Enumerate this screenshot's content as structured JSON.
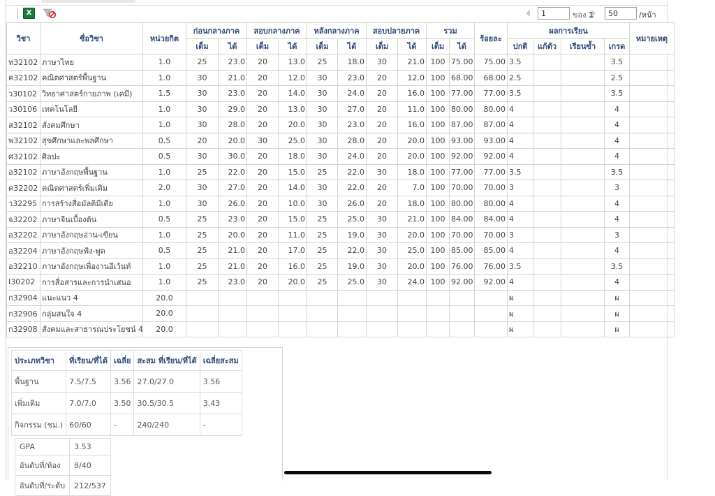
{
  "toolbar": {
    "excel_icon": "X",
    "page_value": "1",
    "of_label": "ของ",
    "total_pages": "1",
    "page_size": "50",
    "per_page_label": "/หน้า"
  },
  "headers": {
    "code": "วิชา",
    "name": "ชื่อวิชา",
    "credit": "หน่วยกิต",
    "groups": [
      "ก่อนกลางภาค",
      "สอบกลางภาค",
      "หลังกลางภาค",
      "สอบปลายภาค",
      "รวม"
    ],
    "percent": "ร้อยละ",
    "result": "ผลการเรียน",
    "remark": "หมายเหตุ",
    "full": "เต็ม",
    "got": "ได้",
    "normal": "ปกติ",
    "fix": "แก้ตัว",
    "repeat": "เรียนซ้ำ",
    "grade": "เกรด"
  },
  "rows": [
    [
      "ท32102",
      "ภาษาไทย",
      "1.0",
      "25",
      "23.0",
      "20",
      "13.0",
      "25",
      "18.0",
      "30",
      "21.0",
      "100",
      "75.00",
      "75.00",
      "3.5",
      "",
      "",
      "3.5",
      ""
    ],
    [
      "ค32102",
      "คณิตศาสตร์พื้นฐาน",
      "1.0",
      "30",
      "21.0",
      "20",
      "12.0",
      "30",
      "23.0",
      "20",
      "12.0",
      "100",
      "68.00",
      "68.00",
      "2.5",
      "",
      "",
      "2.5",
      ""
    ],
    [
      "ว30102",
      "วิทยาศาสตร์กายภาพ (เคมี)",
      "1.5",
      "30",
      "23.0",
      "20",
      "14.0",
      "30",
      "24.0",
      "20",
      "16.0",
      "100",
      "77.00",
      "77.00",
      "3.5",
      "",
      "",
      "3.5",
      ""
    ],
    [
      "ว30106",
      "เทคโนโลยี",
      "1.0",
      "30",
      "29.0",
      "20",
      "13.0",
      "30",
      "27.0",
      "20",
      "11.0",
      "100",
      "80.00",
      "80.00",
      "4",
      "",
      "",
      "4",
      ""
    ],
    [
      "ส32102",
      "สังคมศึกษา",
      "1.0",
      "30",
      "28.0",
      "20",
      "20.0",
      "30",
      "23.0",
      "20",
      "16.0",
      "100",
      "87.00",
      "87.00",
      "4",
      "",
      "",
      "4",
      ""
    ],
    [
      "พ32102",
      "สุขศึกษาและพลศึกษา",
      "0.5",
      "20",
      "20.0",
      "30",
      "25.0",
      "30",
      "28.0",
      "20",
      "20.0",
      "100",
      "93.00",
      "93.00",
      "4",
      "",
      "",
      "4",
      ""
    ],
    [
      "ศ32102",
      "ศิลปะ",
      "0.5",
      "30",
      "30.0",
      "20",
      "18.0",
      "30",
      "24.0",
      "20",
      "20.0",
      "100",
      "92.00",
      "92.00",
      "4",
      "",
      "",
      "4",
      ""
    ],
    [
      "อ32102",
      "ภาษาอังกฤษพื้นฐาน",
      "1.0",
      "25",
      "22.0",
      "20",
      "15.0",
      "25",
      "22.0",
      "30",
      "18.0",
      "100",
      "77.00",
      "77.00",
      "3.5",
      "",
      "",
      "3.5",
      ""
    ],
    [
      "ค32202",
      "คณิตศาสตร์เพิ่มเติม",
      "2.0",
      "30",
      "27.0",
      "20",
      "14.0",
      "30",
      "22.0",
      "20",
      "7.0",
      "100",
      "70.00",
      "70.00",
      "3",
      "",
      "",
      "3",
      ""
    ],
    [
      "ว32295",
      "การสร้างสื่อมัลติมีเดีย",
      "1.0",
      "30",
      "26.0",
      "20",
      "10.0",
      "30",
      "26.0",
      "20",
      "18.0",
      "100",
      "80.00",
      "80.00",
      "4",
      "",
      "",
      "4",
      ""
    ],
    [
      "จ32202",
      "ภาษาจีนเบื้องต้น",
      "0.5",
      "25",
      "23.0",
      "20",
      "15.0",
      "25",
      "25.0",
      "30",
      "21.0",
      "100",
      "84.00",
      "84.00",
      "4",
      "",
      "",
      "4",
      ""
    ],
    [
      "อ32202",
      "ภาษาอังกฤษอ่าน-เขียน",
      "1.0",
      "25",
      "20.0",
      "20",
      "11.0",
      "25",
      "19.0",
      "30",
      "20.0",
      "100",
      "70.00",
      "70.00",
      "3",
      "",
      "",
      "3",
      ""
    ],
    [
      "อ32204",
      "ภาษาอังกฤษฟัง-พูด",
      "0.5",
      "25",
      "21.0",
      "20",
      "17.0",
      "25",
      "22.0",
      "30",
      "25.0",
      "100",
      "85.00",
      "85.00",
      "4",
      "",
      "",
      "4",
      ""
    ],
    [
      "อ32210",
      "ภาษาอังกฤษเพื่องานอีเว้นท์",
      "1.0",
      "25",
      "21.0",
      "20",
      "16.0",
      "25",
      "19.0",
      "30",
      "20.0",
      "100",
      "76.00",
      "76.00",
      "3.5",
      "",
      "",
      "3.5",
      ""
    ],
    [
      "I30202",
      "การสื่อสารและการนำเสนอ",
      "1.0",
      "25",
      "23.0",
      "20",
      "20.0",
      "25",
      "25.0",
      "30",
      "24.0",
      "100",
      "92.00",
      "92.00",
      "4",
      "",
      "",
      "4",
      ""
    ],
    [
      "ก32904",
      "แนะแนว 4",
      "20.0",
      "",
      "",
      "",
      "",
      "",
      "",
      "",
      "",
      "",
      "",
      "",
      "ผ",
      "",
      "",
      "ผ",
      ""
    ],
    [
      "ก32906",
      "กลุ่มสนใจ 4",
      "20.0",
      "",
      "",
      "",
      "",
      "",
      "",
      "",
      "",
      "",
      "",
      "",
      "ผ",
      "",
      "",
      "ผ",
      ""
    ],
    [
      "ก32908",
      "สังคมและสาธารณประโยชน์ 4",
      "20.0",
      "",
      "",
      "",
      "",
      "",
      "",
      "",
      "",
      "",
      "",
      "",
      "ผ",
      "",
      "",
      "ผ",
      ""
    ]
  ],
  "summary": {
    "headers": [
      "ประเภทวิชา",
      "ที่เรียน/ที่ได้",
      "เฉลี่ย",
      "สะสม ที่เรียน/ที่ได้",
      "เฉลี่ยสะสม"
    ],
    "rows": [
      [
        "พื้นฐาน",
        "7.5/7.5",
        "3.56",
        "27.0/27.0",
        "3.56"
      ],
      [
        "เพิ่มเติม",
        "7.0/7.0",
        "3.50",
        "30.5/30.5",
        "3.43"
      ],
      [
        "กิจกรรม (ชม.)",
        "60/60",
        "-",
        "240/240",
        "-"
      ]
    ],
    "gpa": [
      [
        "GPA",
        "3.53"
      ],
      [
        "อันดับที่/ห้อง",
        "8/40"
      ],
      [
        "อันดับที่/ระดับ",
        "212/537"
      ]
    ]
  }
}
